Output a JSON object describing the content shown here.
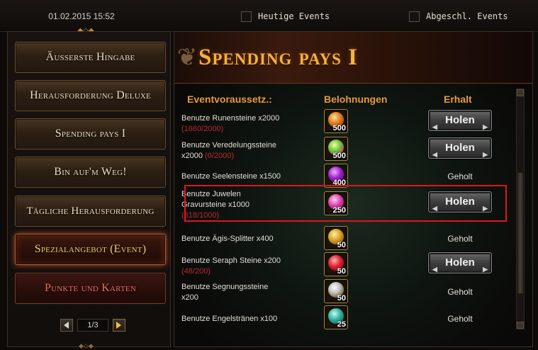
{
  "topbar": {
    "datetime": "01.02.2015 15:52",
    "today_events_label": "Heutige Events",
    "completed_events_label": "Abgeschl. Events"
  },
  "sidebar": {
    "items": [
      {
        "label": "Äusserste Hingabe",
        "state": "normal"
      },
      {
        "label": "Herausforderung Deluxe",
        "state": "normal"
      },
      {
        "label": "Spending pays I",
        "state": "normal"
      },
      {
        "label": "Bin auf'm Weg!",
        "state": "normal"
      },
      {
        "label": "Tägliche Herausforderung",
        "state": "normal"
      },
      {
        "label": "Spezialangebot (Event)",
        "state": "active"
      },
      {
        "label": "Punkte und Karten",
        "state": "red"
      }
    ],
    "pager": "1/3"
  },
  "main": {
    "title": "Spending pays I",
    "headers": {
      "requirement": "Eventvoraussetz.:",
      "rewards": "Belohnungen",
      "receive": "Erhalt"
    },
    "claim_label": "Holen",
    "claimed_label": "Geholt",
    "rows": [
      {
        "line1": "Benutze Runensteine x2000",
        "line2": "",
        "progress": "(1660/2000)",
        "reward_qty": "500",
        "gem": "rune",
        "status": "claim"
      },
      {
        "line1": "Benutze Veredelungssteine",
        "line2": "x2000 ",
        "progress": "(0/2000)",
        "reward_qty": "500",
        "gem": "refine",
        "status": "claim"
      },
      {
        "line1": "Benutze Seelensteine x1500",
        "line2": "",
        "progress": "",
        "reward_qty": "400",
        "gem": "soul",
        "status": "claimed"
      },
      {
        "line1": "Benutze Juwelen",
        "line2": "Gravursteine x1000",
        "progress": "(318/1000)",
        "reward_qty": "250",
        "gem": "jewel",
        "status": "claim"
      },
      {
        "line1": "Benutze Ägis-Splitter x400",
        "line2": "",
        "progress": "",
        "reward_qty": "50",
        "gem": "aegis",
        "status": "claimed"
      },
      {
        "line1": "Benutze Seraph Steine x200",
        "line2": "",
        "progress": "(48/200)",
        "reward_qty": "50",
        "gem": "seraph",
        "status": "claim"
      },
      {
        "line1": "Benutze Segnungssteine",
        "line2": "x200",
        "progress": "",
        "reward_qty": "50",
        "gem": "bless",
        "status": "claimed"
      },
      {
        "line1": "Benutze Engelstränen x100",
        "line2": "",
        "progress": "",
        "reward_qty": "25",
        "gem": "tear",
        "status": "claimed"
      }
    ]
  },
  "colors": {
    "accent_gold": "#e79a3a",
    "title_gold": "#f2b240",
    "progress_red": "#b8282a",
    "highlight_red": "#e0161c"
  }
}
